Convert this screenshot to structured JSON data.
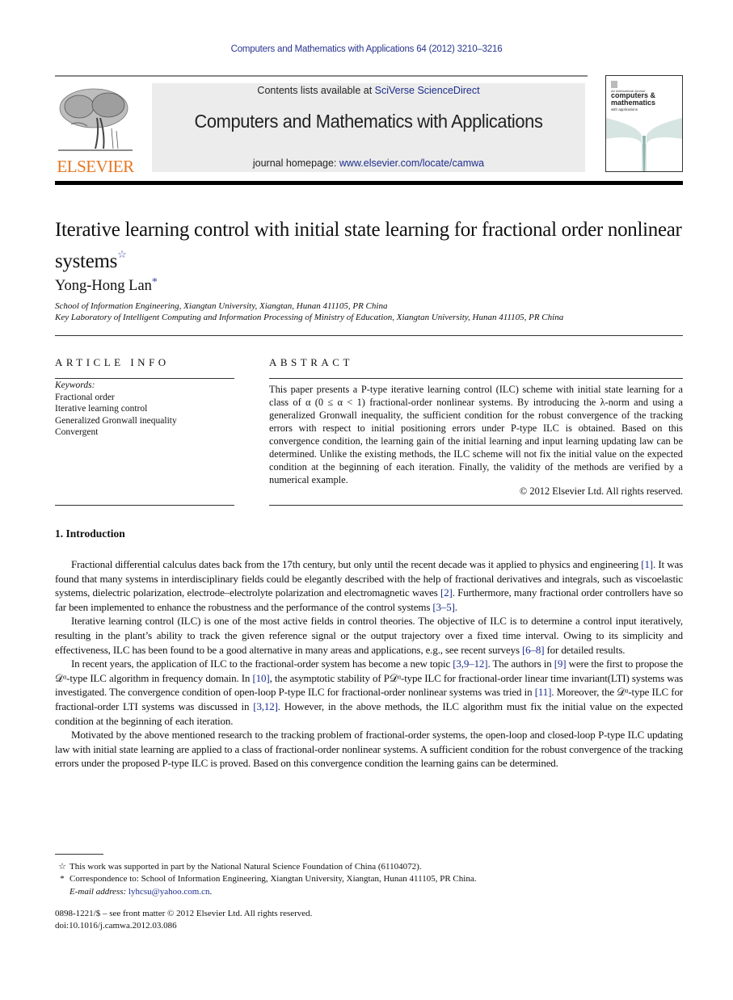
{
  "header": {
    "journal_reference": "Computers and Mathematics with Applications 64 (2012) 3210–3216",
    "publisher_logo_text": "ELSEVIER",
    "contents_prefix": "Contents lists available at ",
    "contents_link": "SciVerse ScienceDirect",
    "journal_title": "Computers and Mathematics with Applications",
    "homepage_prefix": "journal homepage: ",
    "homepage_link": "www.elsevier.com/locate/camwa",
    "cover": {
      "line1": "An International Journal",
      "line2": "computers &",
      "line3": "mathematics",
      "line4": "with applications"
    }
  },
  "article": {
    "title": "Iterative learning control with initial state learning for fractional order nonlinear systems",
    "title_note_mark": "☆",
    "author": "Yong-Hong Lan",
    "author_mark": "*",
    "affiliations": [
      "School of Information Engineering, Xiangtan University, Xiangtan, Hunan 411105, PR China",
      "Key Laboratory of Intelligent Computing and Information Processing of Ministry of Education, Xiangtan University, Hunan 411105, PR China"
    ]
  },
  "article_info": {
    "heading": "ARTICLE INFO",
    "keywords_label": "Keywords:",
    "keywords": [
      "Fractional order",
      "Iterative learning control",
      "Generalized Gronwall inequality",
      "Convergent"
    ]
  },
  "abstract": {
    "heading": "ABSTRACT",
    "text": "This paper presents a P-type iterative learning control (ILC) scheme with initial state learning for a class of α (0 ≤ α < 1) fractional-order nonlinear systems. By introducing the λ-norm and using a generalized Gronwall inequality, the sufficient condition for the robust convergence of the tracking errors with respect to initial positioning errors under P-type ILC is obtained. Based on this convergence condition, the learning gain of the initial learning and input learning updating law can be determined. Unlike the existing methods, the ILC scheme will not fix the initial value on the expected condition at the beginning of each iteration. Finally, the validity of the methods are verified by a numerical example.",
    "copyright": "© 2012 Elsevier Ltd. All rights reserved."
  },
  "introduction": {
    "heading": "1.  Introduction",
    "paragraphs": [
      [
        {
          "t": "Fractional differential calculus dates back from the 17th century, but only until the recent decade was it applied to physics and engineering "
        },
        {
          "t": "[1]",
          "link": true
        },
        {
          "t": ". It was found that many systems in interdisciplinary fields could be elegantly described with the help of fractional derivatives and integrals, such as viscoelastic systems, dielectric polarization, electrode–electrolyte polarization and electromagnetic waves "
        },
        {
          "t": "[2]",
          "link": true
        },
        {
          "t": ". Furthermore, many fractional order controllers have so far been implemented to enhance the robustness and the performance of the control systems "
        },
        {
          "t": "[3–5]",
          "link": true
        },
        {
          "t": "."
        }
      ],
      [
        {
          "t": "Iterative learning control (ILC) is one of the most active fields in control theories. The objective of ILC is to determine a control input iteratively, resulting in the plant’s ability to track the given reference signal or the output trajectory over a fixed time interval. Owing to its simplicity and effectiveness, ILC has been found to be a good alternative in many areas and applications, e.g., see recent surveys "
        },
        {
          "t": "[6–8]",
          "link": true
        },
        {
          "t": " for detailed results."
        }
      ],
      [
        {
          "t": "In recent years, the application of ILC to the fractional-order system has become a new topic "
        },
        {
          "t": "[3,9–12]",
          "link": true
        },
        {
          "t": ". The authors in "
        },
        {
          "t": "[9]",
          "link": true
        },
        {
          "t": " were the first to propose the 𝒟ᵅ-type ILC algorithm in frequency domain. In "
        },
        {
          "t": "[10]",
          "link": true
        },
        {
          "t": ", the asymptotic stability of P𝒟ᵅ-type ILC for fractional-order linear time invariant(LTI) systems was investigated. The convergence condition of open-loop P-type ILC for fractional-order nonlinear systems was tried in "
        },
        {
          "t": "[11]",
          "link": true
        },
        {
          "t": ". Moreover, the 𝒟ᵅ-type ILC for fractional-order LTI systems was discussed in "
        },
        {
          "t": "[3,12]",
          "link": true
        },
        {
          "t": ". However, in the above methods, the ILC algorithm must fix the initial value on the expected condition at the beginning of each iteration."
        }
      ],
      [
        {
          "t": "Motivated by the above mentioned research to the tracking problem of fractional-order systems, the open-loop and closed-loop P-type ILC updating law with initial state learning are applied to a class of fractional-order nonlinear systems. A sufficient condition for the robust convergence of the tracking errors under the proposed P-type ILC is proved. Based on this convergence condition the learning gains can be determined."
        }
      ]
    ]
  },
  "footnotes": {
    "funding_mark": "☆",
    "funding": "This work was supported in part by the National Natural Science Foundation of China (61104072).",
    "correspondence_mark": "*",
    "correspondence": "Correspondence to: School of Information Engineering, Xiangtan University, Xiangtan, Hunan 411105, PR China.",
    "email_label": "E-mail address: ",
    "email": "lyhcsu@yahoo.com.cn",
    "email_suffix": ".",
    "issn_line": "0898-1221/$ – see front matter © 2012 Elsevier Ltd. All rights reserved.",
    "doi": "doi:10.1016/j.camwa.2012.03.086"
  },
  "colors": {
    "link": "#1c2d8c",
    "elsevier_orange": "#e87722",
    "banner_gray": "#ececec"
  }
}
